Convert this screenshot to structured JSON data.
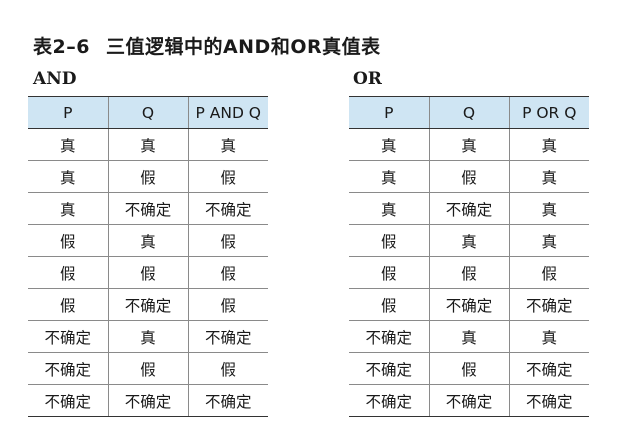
{
  "caption": {
    "number": "表2–6",
    "title": "三值逻辑中的AND和OR真值表"
  },
  "and_table": {
    "label": "AND",
    "headers": [
      "P",
      "Q",
      "P AND Q"
    ],
    "rows": [
      [
        "真",
        "真",
        "真"
      ],
      [
        "真",
        "假",
        "假"
      ],
      [
        "真",
        "不确定",
        "不确定"
      ],
      [
        "假",
        "真",
        "假"
      ],
      [
        "假",
        "假",
        "假"
      ],
      [
        "假",
        "不确定",
        "假"
      ],
      [
        "不确定",
        "真",
        "不确定"
      ],
      [
        "不确定",
        "假",
        "假"
      ],
      [
        "不确定",
        "不确定",
        "不确定"
      ]
    ]
  },
  "or_table": {
    "label": "OR",
    "headers": [
      "P",
      "Q",
      "P OR Q"
    ],
    "rows": [
      [
        "真",
        "真",
        "真"
      ],
      [
        "真",
        "假",
        "真"
      ],
      [
        "真",
        "不确定",
        "真"
      ],
      [
        "假",
        "真",
        "真"
      ],
      [
        "假",
        "假",
        "假"
      ],
      [
        "假",
        "不确定",
        "不确定"
      ],
      [
        "不确定",
        "真",
        "真"
      ],
      [
        "不确定",
        "假",
        "不确定"
      ],
      [
        "不确定",
        "不确定",
        "不确定"
      ]
    ]
  },
  "colors": {
    "header_background": "#cfe5f3",
    "rule": "#8a8a8a"
  }
}
